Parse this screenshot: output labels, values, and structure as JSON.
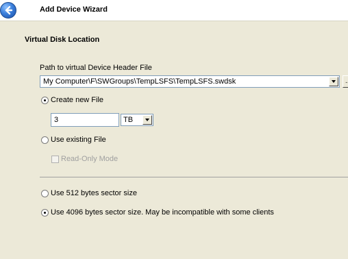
{
  "header": {
    "title": "Add Device Wizard",
    "back_icon": "back-arrow-icon"
  },
  "section": {
    "title": "Virtual Disk Location"
  },
  "path": {
    "label": "Path to virtual Device Header File",
    "value": "My Computer\\F\\SWGroups\\TempLSFS\\TempLSFS.swdsk",
    "browse_label": "..."
  },
  "create_new": {
    "label": "Create new File",
    "selected": true,
    "size_value": "3",
    "unit_value": "TB"
  },
  "use_existing": {
    "label": "Use existing File",
    "selected": false,
    "readonly_label": "Read-Only Mode",
    "readonly_checked": false
  },
  "sector": {
    "opt512_label": "Use 512 bytes sector size",
    "opt512_selected": false,
    "opt4096_label": "Use 4096 bytes sector size. May be incompatible with some clients",
    "opt4096_selected": true
  }
}
